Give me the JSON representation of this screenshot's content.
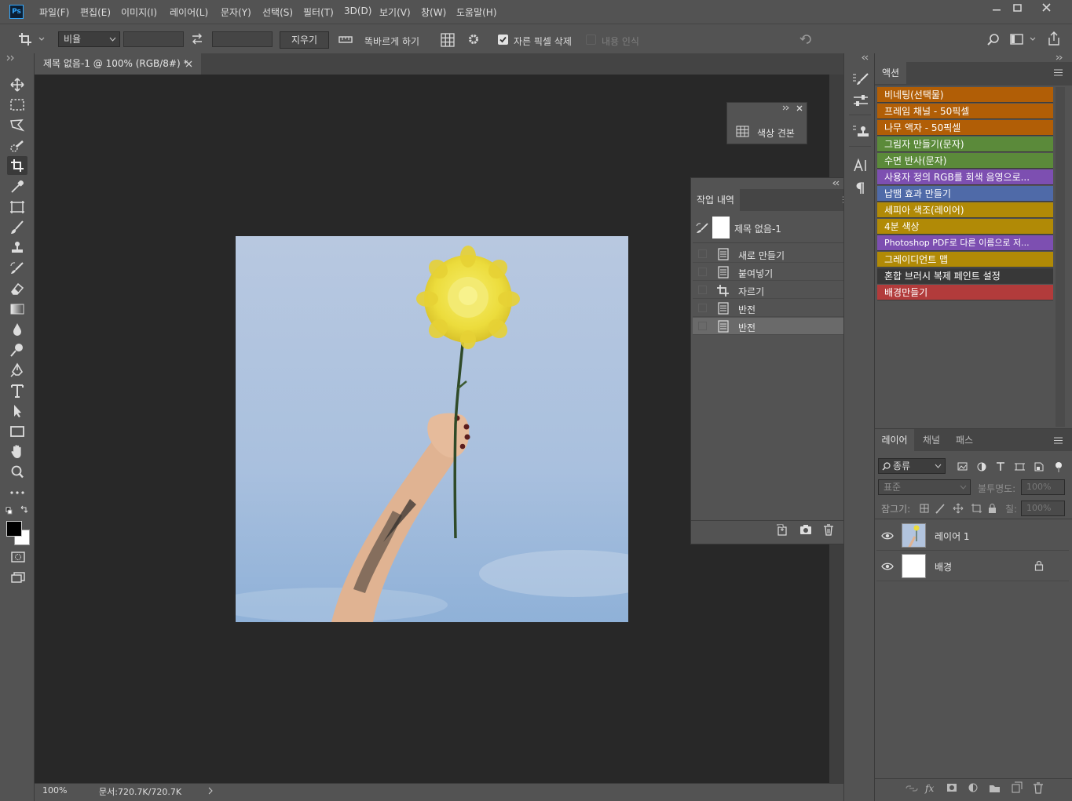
{
  "app": {
    "logo": "Ps"
  },
  "menu": [
    "파일(F)",
    "편집(E)",
    "이미지(I)",
    "레이어(L)",
    "문자(Y)",
    "선택(S)",
    "필터(T)",
    "3D(D)",
    "보기(V)",
    "창(W)",
    "도움말(H)"
  ],
  "options": {
    "ratio_select": "비율",
    "clear_button": "지우기",
    "straighten_label": "똑바르게 하기",
    "delete_cropped_label": "자른 픽셀 삭제",
    "content_aware_label": "내용 인식"
  },
  "document": {
    "tab_title": "제목 없음-1 @ 100% (RGB/8#) *",
    "zoom": "100%",
    "doc_size": "문서:720.7K/720.7K"
  },
  "swatch_panel": {
    "label": "색상 견본"
  },
  "history": {
    "tab": "작업 내역",
    "snapshot": "제목 없음-1",
    "items": [
      "새로 만들기",
      "붙여넣기",
      "자르기",
      "반전",
      "반전"
    ]
  },
  "actions": {
    "tab": "액션",
    "items": [
      {
        "label": "비네팅(선택물)",
        "color": "#b15e06"
      },
      {
        "label": "프레임 채널 - 50픽셀",
        "color": "#b15e06"
      },
      {
        "label": "나무 액자 - 50픽셀",
        "color": "#b15e06"
      },
      {
        "label": "그림자 만들기(문자)",
        "color": "#5b8a3a"
      },
      {
        "label": "수면 반사(문자)",
        "color": "#5b8a3a"
      },
      {
        "label": "사용자 정의 RGB를 회색 음영으로...",
        "color": "#7d4fb1"
      },
      {
        "label": "납땜 효과 만들기",
        "color": "#4f6aa8"
      },
      {
        "label": "세피아 색조(레이어)",
        "color": "#b18a06"
      },
      {
        "label": "4분 색상",
        "color": "#b18a06"
      },
      {
        "label": "Photoshop PDF로 다른 이름으로 저...",
        "color": "#7d4fb1"
      },
      {
        "label": "그레이디언트 맵",
        "color": "#b18a06"
      },
      {
        "label": "혼합 브러시 복제 페인트 설정",
        "color": "#383838"
      },
      {
        "label": "배경만들기",
        "color": "#b23b3b"
      }
    ]
  },
  "layers": {
    "tabs": [
      "레이어",
      "채널",
      "패스"
    ],
    "filter_kind": "종류",
    "blend_mode": "표준",
    "opacity_label": "불투명도:",
    "opacity_value": "100%",
    "lock_label": "잠그기:",
    "fill_label": "칠:",
    "fill_value": "100%",
    "items": [
      "레이어 1",
      "배경"
    ]
  }
}
